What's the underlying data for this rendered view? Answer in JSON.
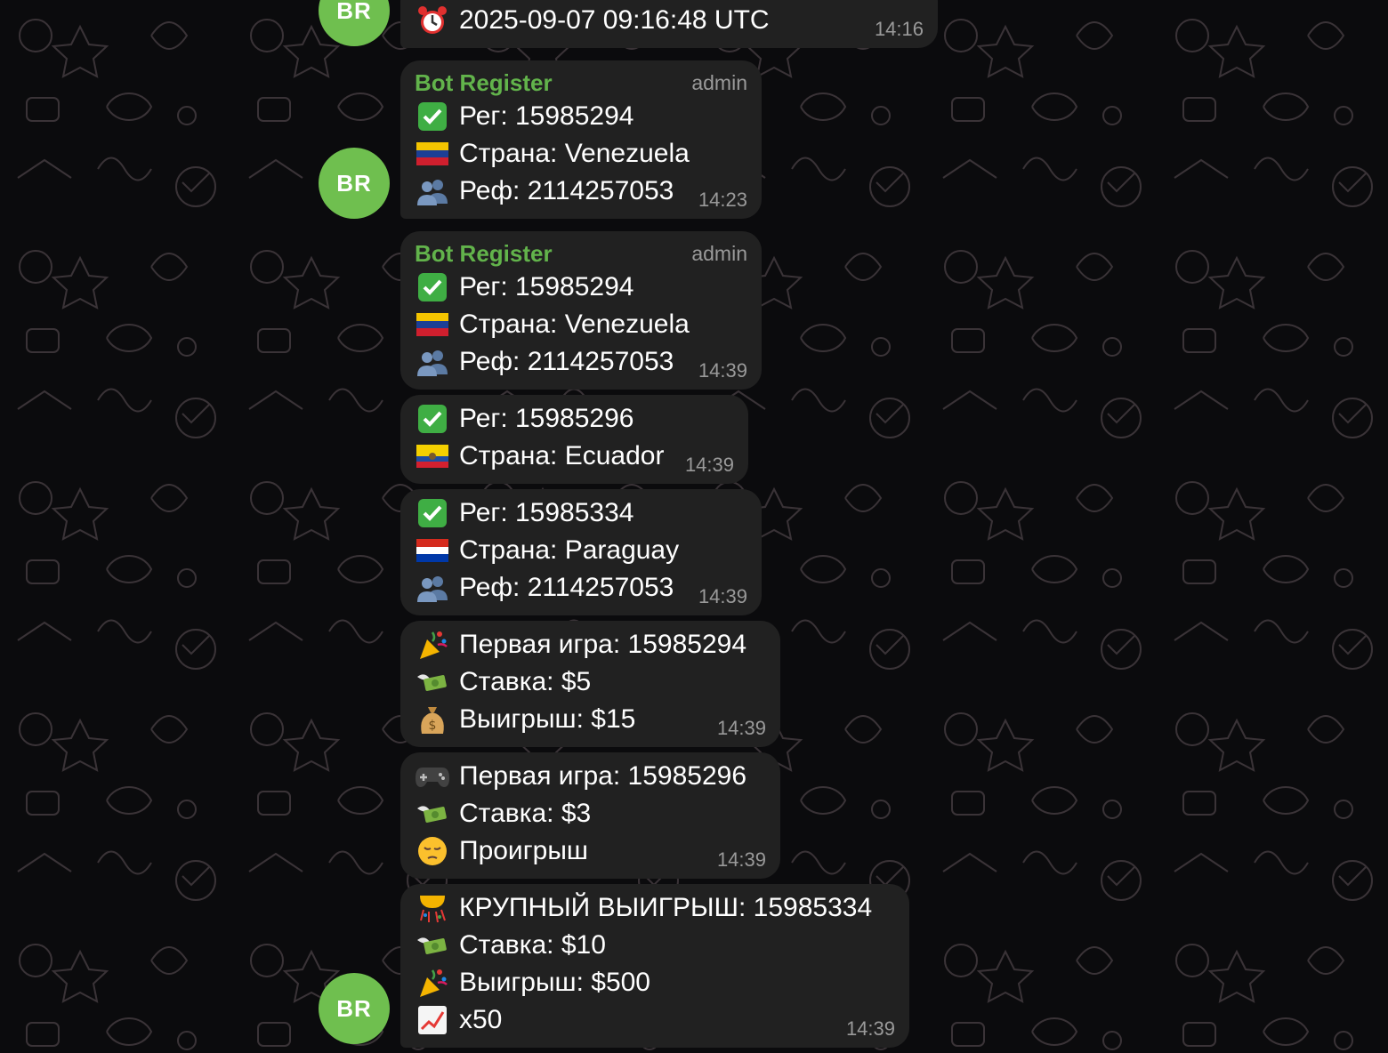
{
  "chat": {
    "msg0": {
      "avatar": "BR",
      "icon": "alarm-clock-icon",
      "text": "2025-09-07 09:16:48 UTC",
      "time": "14:16"
    },
    "msg1": {
      "sender": "Bot Register",
      "role": "admin",
      "time": "14:23",
      "lines": [
        {
          "icon": "check-mark-icon",
          "text": "Рег: 15985294"
        },
        {
          "icon": "venezuela-flag-icon",
          "text": "Страна: Venezuela"
        },
        {
          "icon": "people-icon",
          "text": "Реф: 2114257053"
        }
      ],
      "avatar": "BR"
    },
    "msg2": {
      "sender": "Bot Register",
      "role": "admin",
      "time": "14:39",
      "lines": [
        {
          "icon": "check-mark-icon",
          "text": "Рег: 15985294"
        },
        {
          "icon": "venezuela-flag-icon",
          "text": "Страна: Venezuela"
        },
        {
          "icon": "people-icon",
          "text": "Реф: 2114257053"
        }
      ]
    },
    "msg3": {
      "time": "14:39",
      "lines": [
        {
          "icon": "check-mark-icon",
          "text": "Рег: 15985296"
        },
        {
          "icon": "ecuador-flag-icon",
          "text": "Страна: Ecuador"
        }
      ]
    },
    "msg4": {
      "time": "14:39",
      "lines": [
        {
          "icon": "check-mark-icon",
          "text": "Рег: 15985334"
        },
        {
          "icon": "paraguay-flag-icon",
          "text": "Страна: Paraguay"
        },
        {
          "icon": "people-icon",
          "text": "Реф: 2114257053"
        }
      ]
    },
    "msg5": {
      "time": "14:39",
      "lines": [
        {
          "icon": "party-popper-icon",
          "text": "Первая игра: 15985294"
        },
        {
          "icon": "money-wings-icon",
          "text": "Ставка: $5"
        },
        {
          "icon": "money-bag-icon",
          "text": "Выигрыш: $15"
        }
      ]
    },
    "msg6": {
      "time": "14:39",
      "lines": [
        {
          "icon": "game-controller-icon",
          "text": "Первая игра: 15985296"
        },
        {
          "icon": "money-wings-icon",
          "text": "Ставка: $3"
        },
        {
          "icon": "pensive-face-icon",
          "text": "Проигрыш"
        }
      ]
    },
    "msg7": {
      "time": "14:39",
      "avatar": "BR",
      "lines": [
        {
          "icon": "confetti-ball-icon",
          "text": "КРУПНЫЙ ВЫИГРЫШ: 15985334"
        },
        {
          "icon": "money-wings-icon",
          "text": "Ставка: $10"
        },
        {
          "icon": "party-popper-icon",
          "text": "Выигрыш: $500"
        },
        {
          "icon": "chart-increasing-icon",
          "text": "x50"
        }
      ]
    }
  },
  "colors": {
    "background": "#0b0b0d",
    "bubble": "#212121",
    "sender_name": "#62b34b",
    "avatar": "#6fbf4f",
    "meta_text": "#9a9a9a"
  }
}
